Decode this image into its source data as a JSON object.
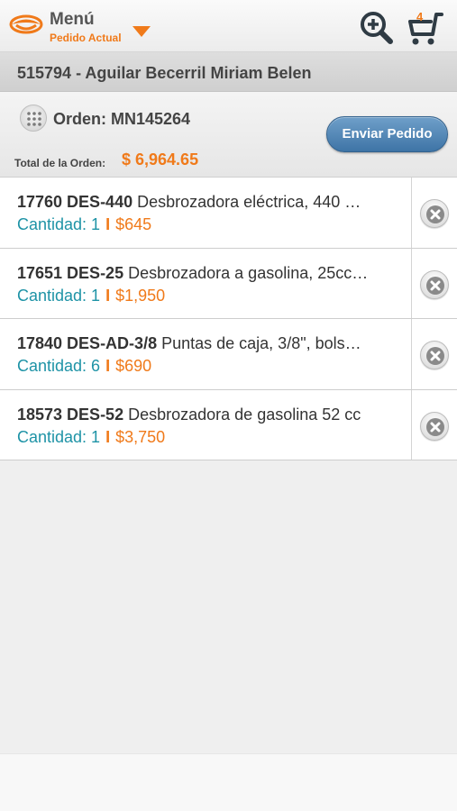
{
  "header": {
    "menu_label": "Menú",
    "menu_sub": "Pedido Actual",
    "cart_count": "4",
    "icons": [
      "logo-icon",
      "caret-down-icon",
      "zoom-in-icon",
      "cart-icon"
    ]
  },
  "customer": {
    "title": "515794 - Aguilar Becerril Miriam Belen"
  },
  "order": {
    "label": "Orden: MN145264",
    "total_label": "Total de la Orden:",
    "total_value": "$ 6,964.65",
    "send_button": "Enviar Pedido"
  },
  "items": [
    {
      "code": "17760 DES-440",
      "desc": "Desbrozadora eléctrica, 440 …",
      "qty": "Cantidad: 1",
      "sep": "I",
      "price": "$645"
    },
    {
      "code": "17651 DES-25",
      "desc": "Desbrozadora a gasolina, 25cc…",
      "qty": "Cantidad: 1",
      "sep": "I",
      "price": "$1,950"
    },
    {
      "code": "17840 DES-AD-3/8",
      "desc": "Puntas de caja, 3/8\", bols…",
      "qty": "Cantidad: 6",
      "sep": "I",
      "price": "$690"
    },
    {
      "code": "18573 DES-52",
      "desc": "Desbrozadora de gasolina 52 cc",
      "qty": "Cantidad: 1",
      "sep": "I",
      "price": "$3,750"
    }
  ],
  "colors": {
    "accent": "#f07a1a",
    "quantity": "#1e93a6",
    "button": "#3e74a6"
  }
}
